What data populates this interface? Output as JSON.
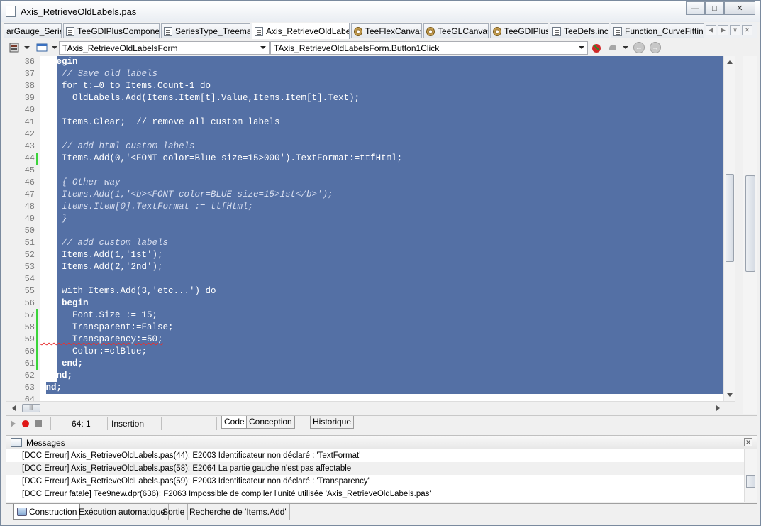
{
  "window": {
    "title": "Axis_RetrieveOldLabels.pas"
  },
  "tabs": [
    {
      "label": "arGauge_Series",
      "icon": "unit-file-icon"
    },
    {
      "label": "TeeGDIPlusComponent",
      "icon": "unit-file-icon"
    },
    {
      "label": "SeriesType_Treemap",
      "icon": "unit-file-icon"
    },
    {
      "label": "Axis_RetrieveOldLabels",
      "icon": "unit-file-icon",
      "active": true
    },
    {
      "label": "TeeFlexCanvas",
      "icon": "component-cog-icon"
    },
    {
      "label": "TeeGLCanvas",
      "icon": "component-cog-icon"
    },
    {
      "label": "TeeGDIPlus",
      "icon": "component-cog-icon"
    },
    {
      "label": "TeeDefs.inc",
      "icon": "include-file-icon"
    },
    {
      "label": "Function_CurveFitting",
      "icon": "unit-file-icon"
    }
  ],
  "toolbar": {
    "class_combo": "TAxis_RetrieveOldLabelsForm",
    "method_combo": "TAxis_RetrieveOldLabelsForm.Button1Click"
  },
  "editor": {
    "lines": [
      {
        "num": "36",
        "text": "  begin"
      },
      {
        "num": "37",
        "text": "    // Save old labels"
      },
      {
        "num": "38",
        "text": "    for t:=0 to Items.Count-1 do"
      },
      {
        "num": "39",
        "text": "      OldLabels.Add(Items.Item[t].Value,Items.Item[t].Text);"
      },
      {
        "num": "40",
        "text": ""
      },
      {
        "num": "41",
        "text": "    Items.Clear;  // remove all custom labels"
      },
      {
        "num": "42",
        "text": ""
      },
      {
        "num": "43",
        "text": "    // add html custom labels"
      },
      {
        "num": "44",
        "text": "    Items.Add(0,'<FONT color=Blue size=15>000').TextFormat:=ttfHtml;"
      },
      {
        "num": "45",
        "text": ""
      },
      {
        "num": "46",
        "text": "    { Other way"
      },
      {
        "num": "47",
        "text": "    Items.Add(1,'<b><FONT color=BLUE size=15>1st</b>');"
      },
      {
        "num": "48",
        "text": "    items.Item[0].TextFormat := ttfHtml;"
      },
      {
        "num": "49",
        "text": "    }"
      },
      {
        "num": "50",
        "text": ""
      },
      {
        "num": "51",
        "text": "    // add custom labels"
      },
      {
        "num": "52",
        "text": "    Items.Add(1,'1st');"
      },
      {
        "num": "53",
        "text": "    Items.Add(2,'2nd');"
      },
      {
        "num": "54",
        "text": ""
      },
      {
        "num": "55",
        "text": "    with Items.Add(3,'etc...') do"
      },
      {
        "num": "56",
        "text": "    begin"
      },
      {
        "num": "57",
        "text": "      Font.Size := 15;"
      },
      {
        "num": "58",
        "text": "      Transparent:=False;"
      },
      {
        "num": "59",
        "text": "      Transparency:=50;"
      },
      {
        "num": "60",
        "text": "      Color:=clBlue;"
      },
      {
        "num": "61",
        "text": "    end;"
      },
      {
        "num": "62",
        "text": "  end;"
      },
      {
        "num": "63",
        "text": "end;"
      },
      {
        "num": "64",
        "text": ""
      }
    ]
  },
  "status": {
    "position": "64:  1",
    "mode": "Insertion",
    "tabs": [
      "Code",
      "Conception",
      "Historique"
    ]
  },
  "messages": {
    "title": "Messages",
    "items": [
      "[DCC Erreur] Axis_RetrieveOldLabels.pas(44): E2003 Identificateur non déclaré : 'TextFormat'",
      "[DCC Erreur] Axis_RetrieveOldLabels.pas(58): E2064 La partie gauche n'est pas affectable",
      "[DCC Erreur] Axis_RetrieveOldLabels.pas(59): E2003 Identificateur non déclaré : 'Transparency'",
      "[DCC Erreur fatale] Tee9new.dpr(636): F2063 Impossible de compiler l'unité utilisée 'Axis_RetrieveOldLabels.pas'"
    ]
  },
  "bottom_tabs": [
    "Construction",
    "Exécution automatique",
    "Sortie",
    "Recherche de 'Items.Add'"
  ],
  "colors": {
    "selection": "#5470a5",
    "modified_marker": "#3ad43a",
    "error_squiggle": "#e83030"
  }
}
